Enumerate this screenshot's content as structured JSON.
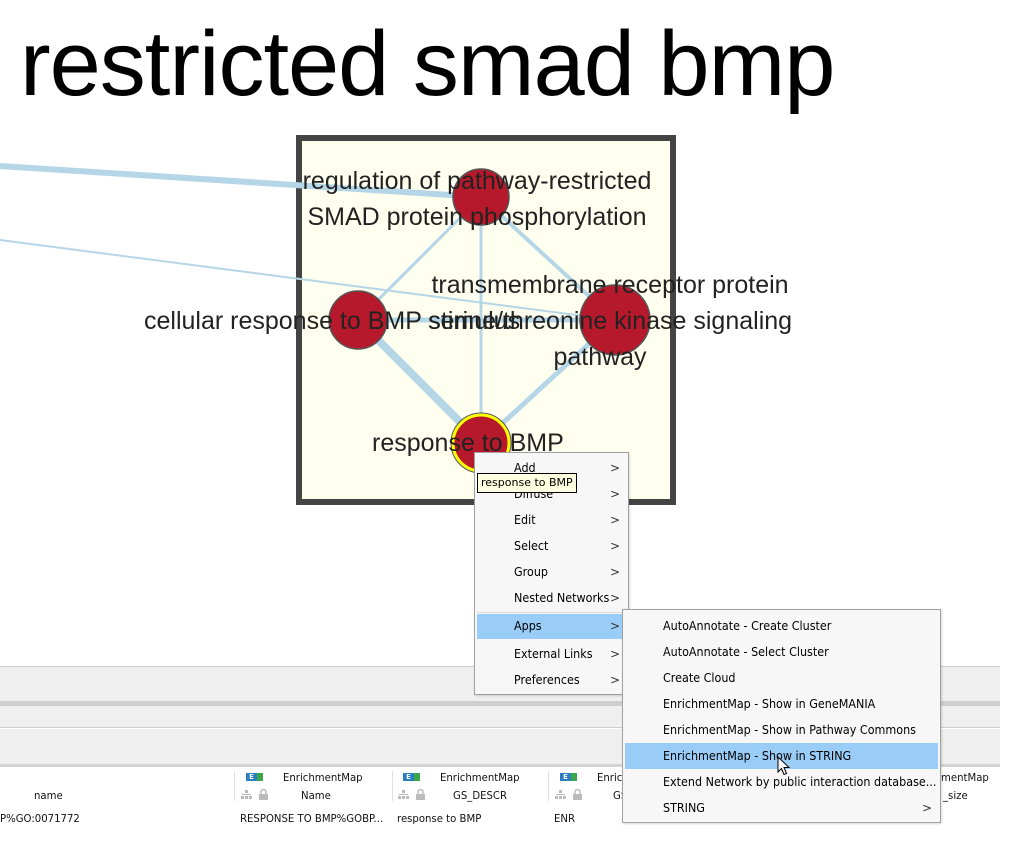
{
  "canvas": {
    "annotation_title": "restricted smad bmp",
    "cluster_fill": "#fffff0",
    "cluster_border": "#444444",
    "edge_color": "#b5d6e6",
    "node_color": "#b5192b",
    "selected_node_border": "#ffff00",
    "nodes": [
      {
        "id": "n1",
        "label_lines": [
          "regulation of pathway-restricted",
          "SMAD protein phosphorylation"
        ]
      },
      {
        "id": "n2",
        "label_lines": [
          "cellular response to BMP stimulus"
        ]
      },
      {
        "id": "n3",
        "label_lines": [
          "transmembrane receptor protein",
          "serine/threonine kinase signaling",
          "pathway"
        ]
      },
      {
        "id": "n4",
        "label_lines": [
          "response to BMP"
        ],
        "selected": true
      }
    ]
  },
  "tooltip": "response to BMP",
  "context_menu": {
    "items": [
      {
        "label": "Add",
        "submenu": true
      },
      {
        "label": "Diffuse",
        "submenu": true
      },
      {
        "label": "Edit",
        "submenu": true
      },
      {
        "label": "Select",
        "submenu": true
      },
      {
        "label": "Group",
        "submenu": true
      },
      {
        "label": "Nested Networks",
        "submenu": true
      },
      {
        "label": "Apps",
        "submenu": true,
        "active": true
      },
      {
        "label": "External Links",
        "submenu": true
      },
      {
        "label": "Preferences",
        "submenu": true
      }
    ],
    "arrow": ">"
  },
  "apps_menu": {
    "items": [
      {
        "label": "AutoAnnotate - Create Cluster"
      },
      {
        "label": "AutoAnnotate - Select Cluster"
      },
      {
        "label": "Create Cloud"
      },
      {
        "label": "EnrichmentMap - Show in GeneMANIA"
      },
      {
        "label": "EnrichmentMap - Show in Pathway Commons"
      },
      {
        "label": "EnrichmentMap - Show in STRING",
        "active": true
      },
      {
        "label": "Extend Network by public interaction database..."
      },
      {
        "label": "STRING",
        "submenu": true
      }
    ]
  },
  "table": {
    "columns": [
      {
        "namespace": "",
        "name": "name"
      },
      {
        "namespace": "EnrichmentMap",
        "name": "Name"
      },
      {
        "namespace": "EnrichmentMap",
        "name": "GS_DESCR"
      },
      {
        "namespace": "EnrichmentMap",
        "name": "GS_TYPE"
      },
      {
        "namespace": "EnrichmentMap",
        "name": "gs_size"
      }
    ],
    "em_icon_text": "E",
    "row": {
      "name": "P%GO:0071772",
      "em_name": "RESPONSE TO BMP%GOBP...",
      "gs_descr": "response to BMP",
      "gs_type": "ENR"
    },
    "visible_header_fragments": {
      "col4_ns": "Enrich",
      "col4_name": "GS",
      "col5_ns": "mentMap",
      "col5_name": "_size"
    }
  }
}
